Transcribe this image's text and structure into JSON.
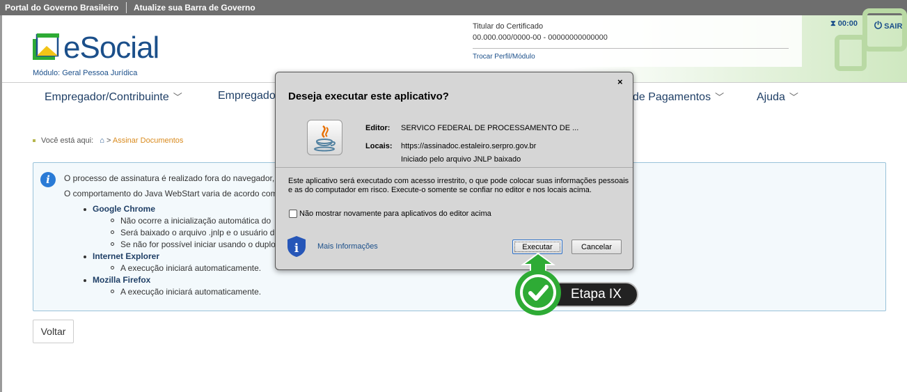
{
  "gov_bar": {
    "portal": "Portal do Governo Brasileiro",
    "atualize": "Atualize sua Barra de Governo"
  },
  "header": {
    "logo_text": "eSocial",
    "modulo": "Módulo: Geral Pessoa Jurídica",
    "cert_title": "Titular do Certificado",
    "cert_id": "00.000.000/0000-00 - 00000000000000",
    "trocar": "Trocar Perfil/Módulo",
    "timer": "00:00",
    "sair": "SAIR"
  },
  "nav": {
    "items": [
      "Empregador/Contribuinte",
      "Empregado",
      "de Pagamentos",
      "Ajuda"
    ]
  },
  "breadcrumb": {
    "prefix": "Você está aqui:",
    "sep": ">",
    "current": "Assinar Documentos"
  },
  "info": {
    "line1": "O processo de assinatura é realizado fora do navegador,",
    "line2": "O comportamento do Java WebStart varia de acordo com",
    "chrome": "Google Chrome",
    "chrome_items": [
      "Não ocorre a inicialização automática do",
      "Será baixado o arquivo .jnlp e o usuário de",
      "Se não for possível iniciar usando o duplo"
    ],
    "ie": "Internet Explorer",
    "ie_item": "A execução iniciará automaticamente.",
    "ff": "Mozilla Firefox",
    "ff_item": "A execução iniciará automaticamente."
  },
  "voltar": "Voltar",
  "dialog": {
    "close": "×",
    "title": "Deseja executar este aplicativo?",
    "editor_label": "Editor:",
    "editor_value": "SERVICO FEDERAL DE PROCESSAMENTO DE ...",
    "locais_label": "Locais:",
    "locais_value": "https://assinadoc.estaleiro.serpro.gov.br",
    "jnlp": "Iniciado pelo arquivo JNLP baixado",
    "warning1": "Este aplicativo será executado com acesso irrestrito, o que pode colocar suas informações pessoais",
    "warning2": "e as do computador em risco. Execute-o somente se confiar no editor e nos locais acima.",
    "checkbox": "Não mostrar novamente para aplicativos do editor acima",
    "mais": "Mais Informações",
    "executar": "Executar",
    "cancelar": "Cancelar"
  },
  "step": {
    "label": "Etapa IX"
  },
  "colors": {
    "brand_blue": "#1b4f8a",
    "brand_green": "#2eab35",
    "info_blue": "#2a7bd6",
    "crumb_orange": "#d98a1d"
  }
}
